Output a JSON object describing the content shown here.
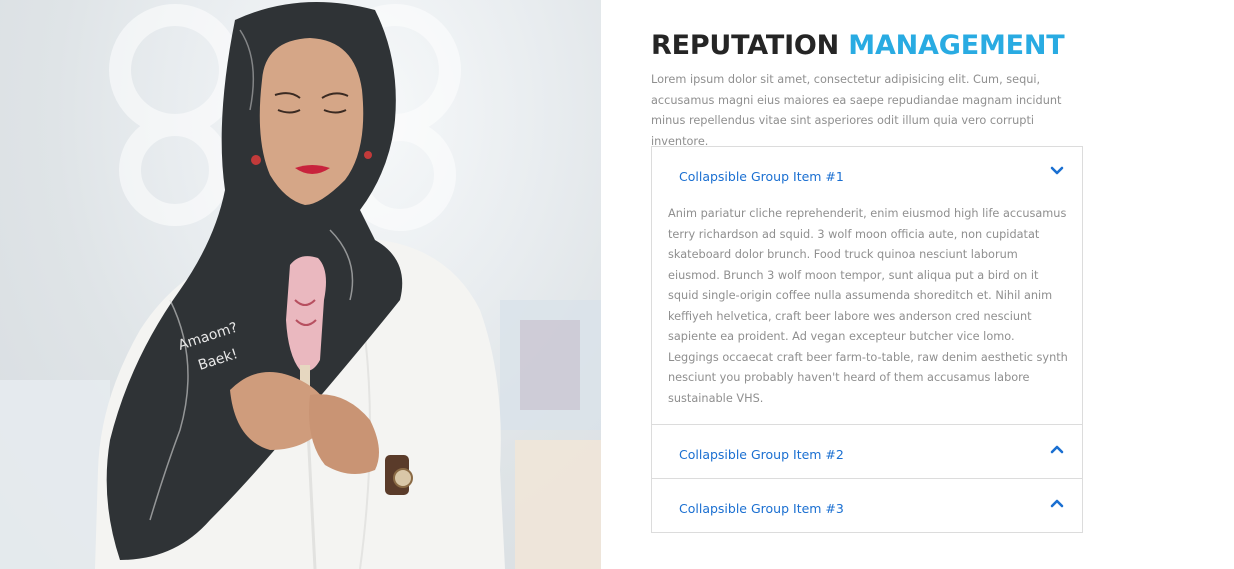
{
  "section": {
    "title_part1": "REPUTATION",
    "title_part2": "MANAGEMENT",
    "intro": "Lorem ipsum dolor sit amet, consectetur adipisicing elit. Cum, sequi, accusamus magni eius maiores ea saepe repudiandae magnam incidunt minus repellendus vitae sint asperiores odit illum quia vero corrupti inventore."
  },
  "accordion": {
    "items": [
      {
        "title": "Collapsible Group Item #1",
        "expanded": true,
        "icon": "chevron-down-icon",
        "body": "Anim pariatur cliche reprehenderit, enim eiusmod high life accusamus terry richardson ad squid. 3 wolf moon officia aute, non cupidatat skateboard dolor brunch. Food truck quinoa nesciunt laborum eiusmod. Brunch 3 wolf moon tempor, sunt aliqua put a bird on it squid single-origin coffee nulla assumenda shoreditch et. Nihil anim keffiyeh helvetica, craft beer labore wes anderson cred nesciunt sapiente ea proident. Ad vegan excepteur butcher vice lomo. Leggings occaecat craft beer farm-to-table, raw denim aesthetic synth nesciunt you probably haven't heard of them accusamus labore sustainable VHS."
      },
      {
        "title": "Collapsible Group Item #2",
        "expanded": false,
        "icon": "chevron-up-icon"
      },
      {
        "title": "Collapsible Group Item #3",
        "expanded": false,
        "icon": "chevron-up-icon"
      }
    ]
  },
  "colors": {
    "heading_dark": "#252525",
    "heading_accent": "#29abe2",
    "link_blue": "#1a6fd1",
    "body_text": "#8f8f8f",
    "border": "#dcdcdc"
  },
  "photo": {
    "scarf_text_1": "Amaom?",
    "scarf_text_2": "Baek!"
  }
}
